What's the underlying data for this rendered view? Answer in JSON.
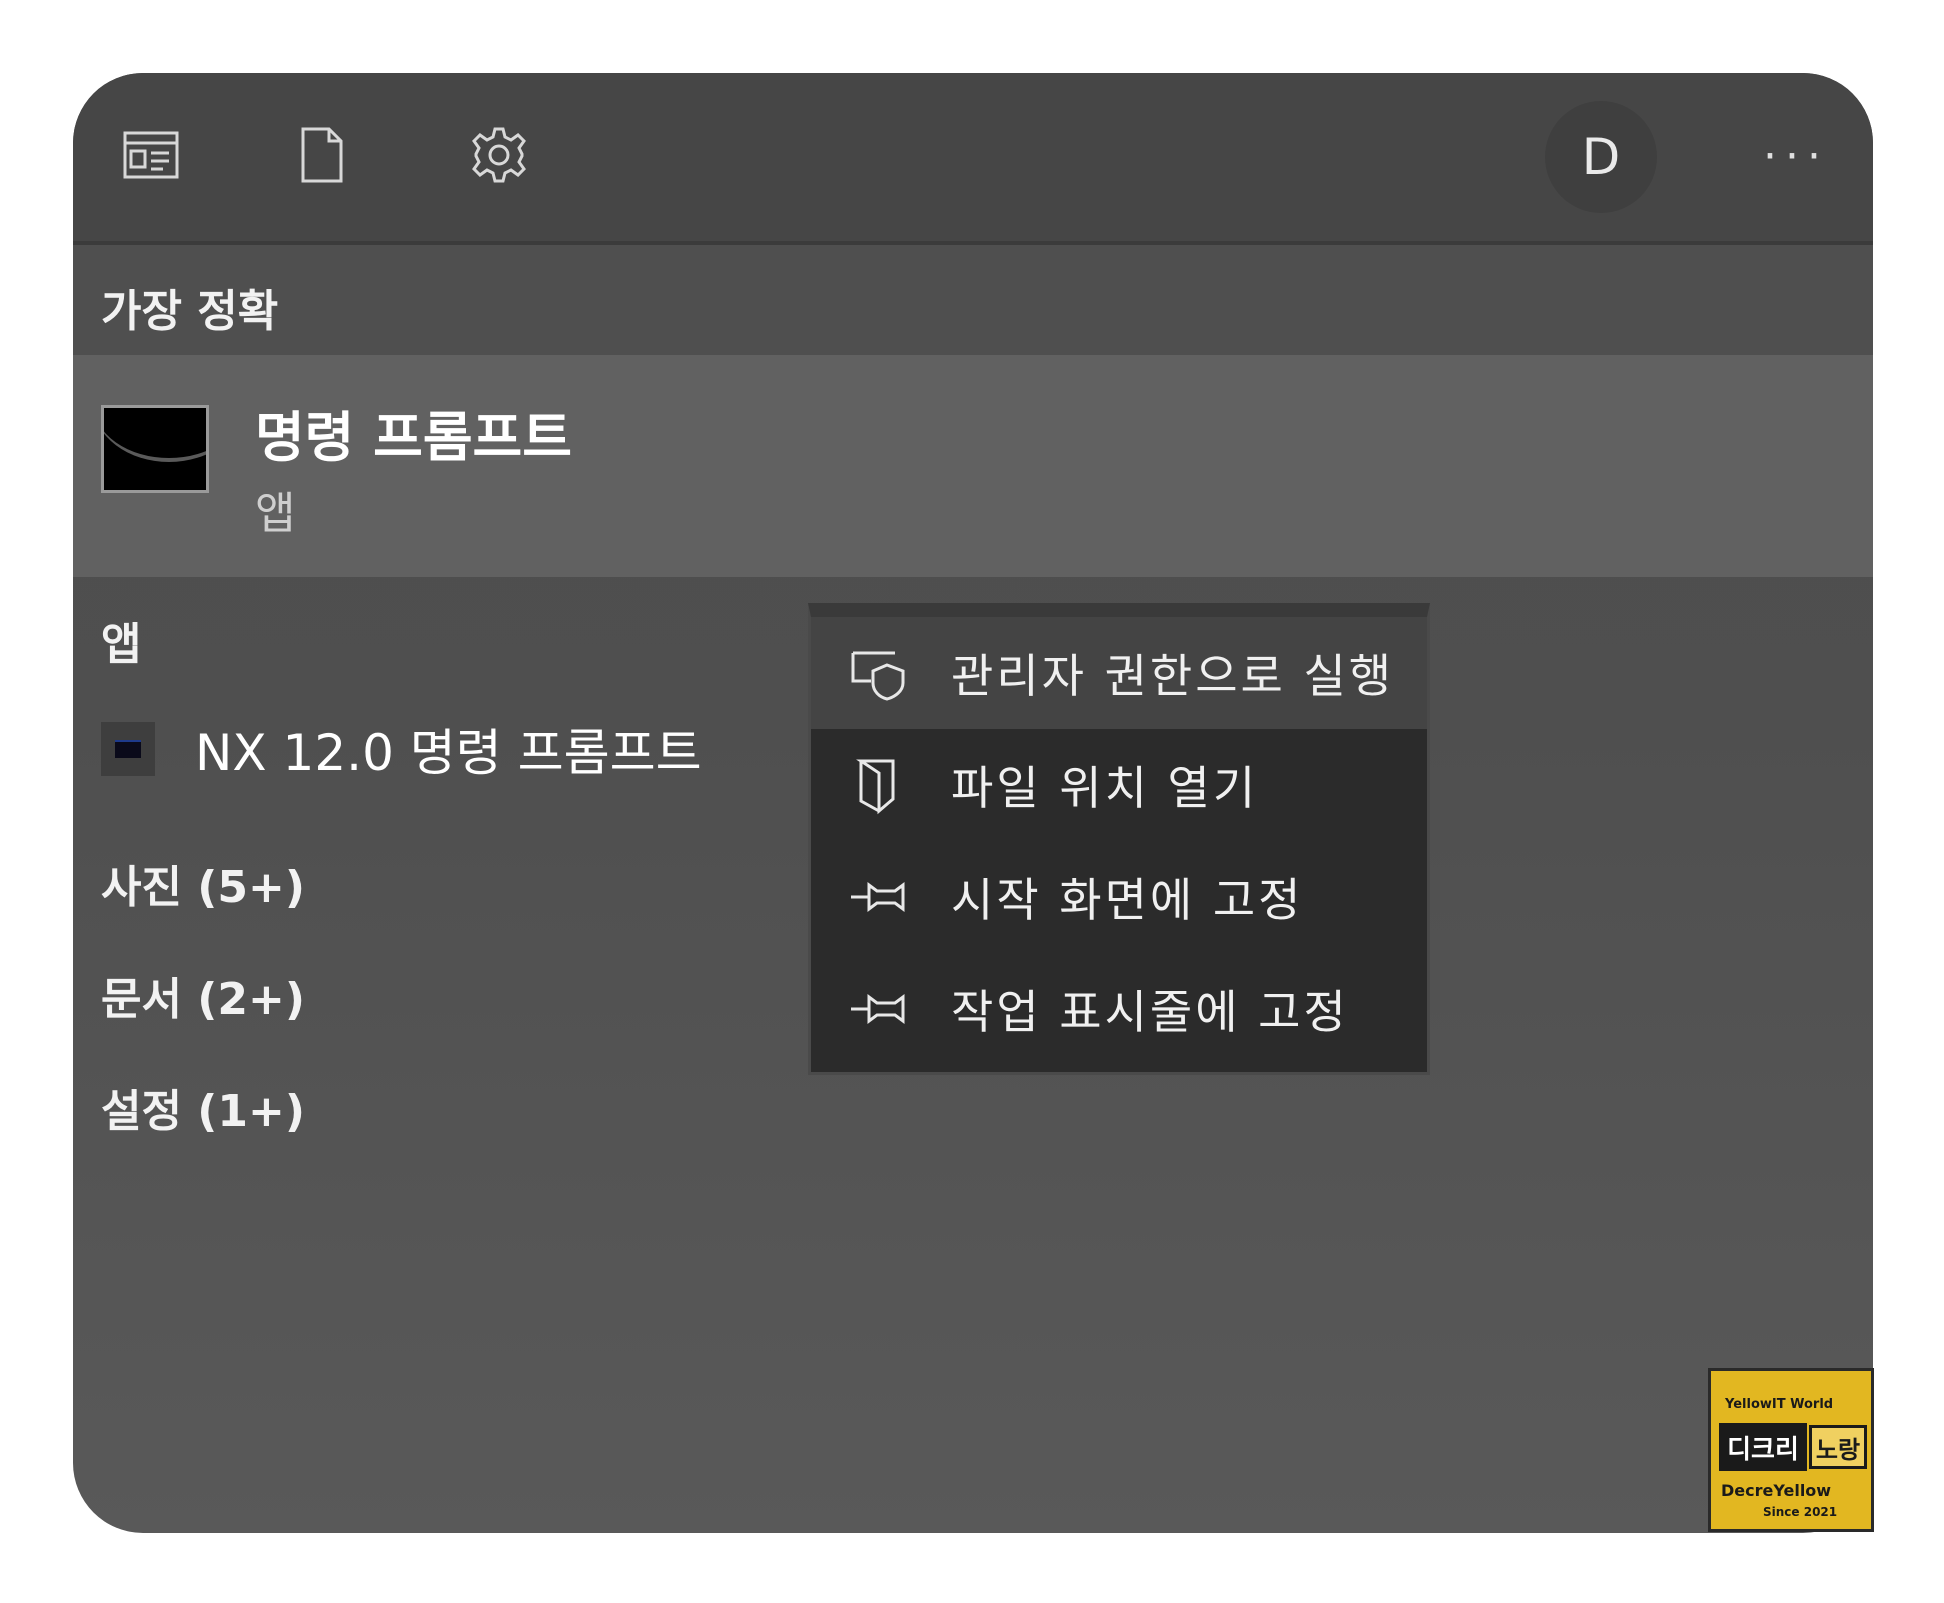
{
  "topbar": {
    "icons": [
      "apps-icon",
      "document-icon",
      "settings-icon"
    ],
    "avatar_letter": "D",
    "more_label": "···"
  },
  "best_match": {
    "header": "가장 정확",
    "title": "명령 프롬프트",
    "subtitle": "앱"
  },
  "sections": {
    "apps_label": "앱",
    "app_item": "NX 12.0 명령 프롬프트",
    "photos": "사진 (5+)",
    "documents": "문서 (2+)",
    "settings": "설정 (1+)"
  },
  "context_menu": {
    "items": [
      {
        "label": "관리자 권한으로 실행",
        "icon": "shield-icon",
        "highlighted": true
      },
      {
        "label": "파일 위치 열기",
        "icon": "folder-open-icon",
        "highlighted": false
      },
      {
        "label": "시작 화면에 고정",
        "icon": "pin-icon",
        "highlighted": false
      },
      {
        "label": "작업 표시줄에 고정",
        "icon": "pin-icon",
        "highlighted": false
      }
    ]
  },
  "watermark": {
    "line1": "YellowIT World",
    "line2a": "디크리",
    "line2b": "노랑",
    "line3": "DecreYellow",
    "line4": "Since 2021"
  },
  "colors": {
    "panel": "#4f4f4f",
    "best_row": "#616161",
    "menu_bg": "#2b2b2b",
    "menu_highlight": "#444444",
    "logo": "#e2b721"
  }
}
